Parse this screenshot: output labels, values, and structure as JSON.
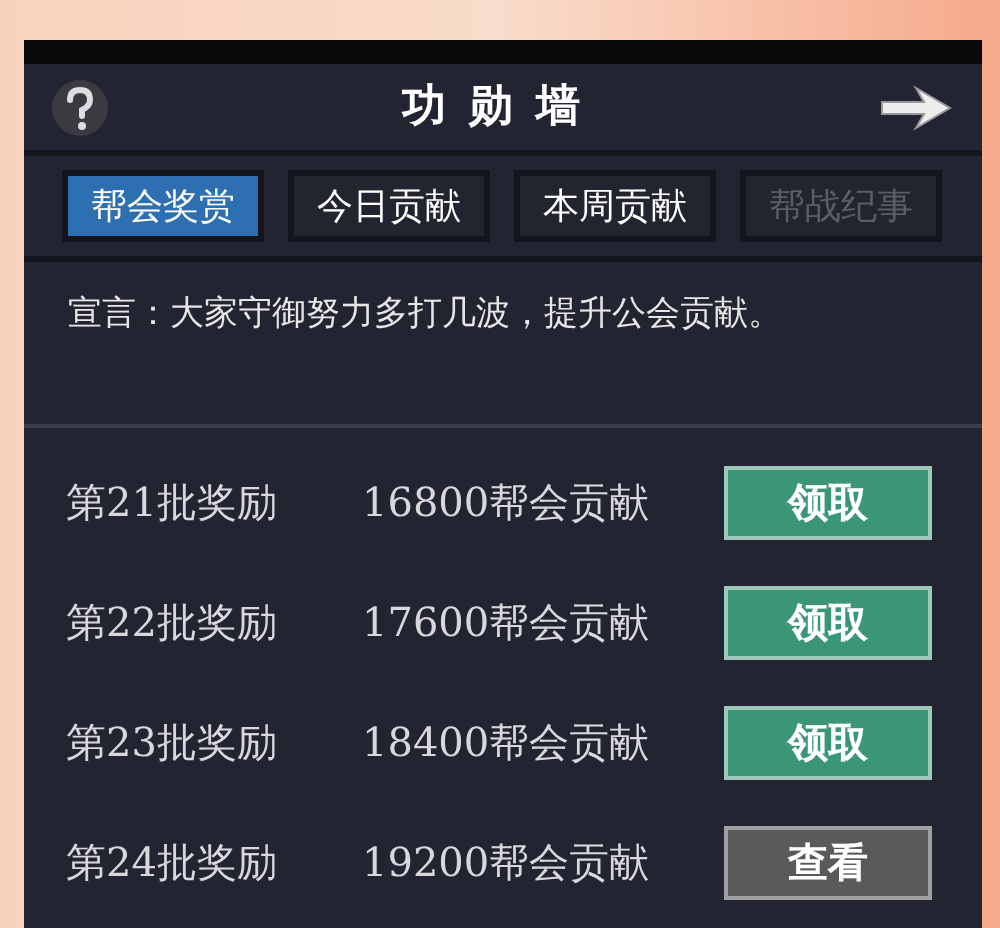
{
  "window": {
    "title": "功 勋 墙"
  },
  "tabs": [
    {
      "label": "帮会奖赏",
      "selected": true,
      "disabled": false
    },
    {
      "label": "今日贡献",
      "selected": false,
      "disabled": false
    },
    {
      "label": "本周贡献",
      "selected": false,
      "disabled": false
    },
    {
      "label": "帮战纪事",
      "selected": false,
      "disabled": true
    }
  ],
  "announcement": "宣言：大家守御努力多打几波，提升公会贡献。",
  "rewards": [
    {
      "name": "第21批奖励",
      "requirement": "16800帮会贡献",
      "button": {
        "label": "领取",
        "kind": "claim"
      }
    },
    {
      "name": "第22批奖励",
      "requirement": "17600帮会贡献",
      "button": {
        "label": "领取",
        "kind": "claim"
      }
    },
    {
      "name": "第23批奖励",
      "requirement": "18400帮会贡献",
      "button": {
        "label": "领取",
        "kind": "claim"
      }
    },
    {
      "name": "第24批奖励",
      "requirement": "19200帮会贡献",
      "button": {
        "label": "查看",
        "kind": "view"
      }
    }
  ]
}
